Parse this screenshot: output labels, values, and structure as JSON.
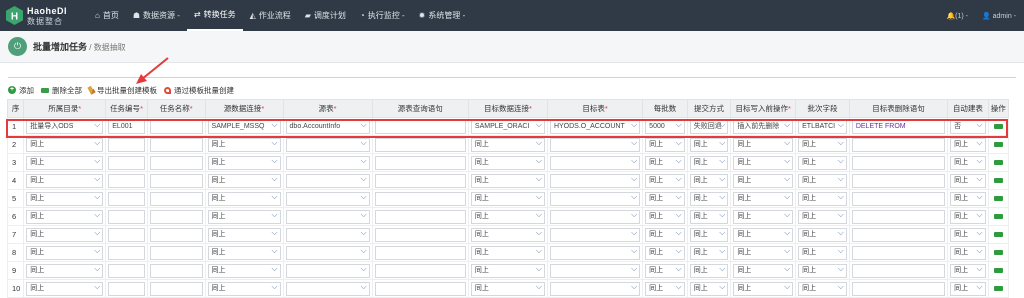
{
  "app": {
    "logo_title": "HaoheDI",
    "logo_subtitle": "数据整合"
  },
  "nav": {
    "items": [
      {
        "icon": "home-icon",
        "glyph": "⌂",
        "label": "首页",
        "active": false
      },
      {
        "icon": "database-icon",
        "glyph": "☗",
        "label": "数据资源 -",
        "active": false
      },
      {
        "icon": "transform-icon",
        "glyph": "⇄",
        "label": "转换任务",
        "active": true
      },
      {
        "icon": "workflow-icon",
        "glyph": "◭",
        "label": "作业流程",
        "active": false
      },
      {
        "icon": "schedule-icon",
        "glyph": "▰",
        "label": "调度计划",
        "active": false
      },
      {
        "icon": "monitor-icon",
        "glyph": "◔",
        "label": "执行监控 -",
        "active": false
      },
      {
        "icon": "settings-icon",
        "glyph": "✹",
        "label": "系统管理 -",
        "active": false
      }
    ],
    "notifications": "🔔(1) -",
    "user": "👤 admin -"
  },
  "breadcrumb": {
    "title": "批量增加任务",
    "separator": " / ",
    "sub": "数据抽取"
  },
  "toolbar": {
    "add": "添加",
    "delete_all": "删除全部",
    "export_template": "导出批量创建模板",
    "import_template": "通过模板批量创建"
  },
  "table": {
    "headers": [
      {
        "label": "序",
        "req": false
      },
      {
        "label": "所属目录",
        "req": true
      },
      {
        "label": "任务编号",
        "req": true
      },
      {
        "label": "任务名称",
        "req": true
      },
      {
        "label": "源数据连接",
        "req": true
      },
      {
        "label": "源表",
        "req": true
      },
      {
        "label": "源表查询语句",
        "req": false
      },
      {
        "label": "目标数据连接",
        "req": true
      },
      {
        "label": "目标表",
        "req": true
      },
      {
        "label": "每批数",
        "req": false
      },
      {
        "label": "提交方式",
        "req": false
      },
      {
        "label": "目标写入前操作",
        "req": true
      },
      {
        "label": "批次字段",
        "req": false
      },
      {
        "label": "目标表删除语句",
        "req": false
      },
      {
        "label": "自动建表",
        "req": false
      },
      {
        "label": "操作",
        "req": false
      }
    ],
    "rows": [
      {
        "no": "1",
        "dir": "批量导入ODS",
        "code": "EL001",
        "name": "",
        "src_conn": "SAMPLE_MSSQ",
        "src_table": "dbo.AccountInfo",
        "src_sql": "",
        "tgt_conn": "SAMPLE_ORACI",
        "tgt_table": "HYODS.O_ACCOUNT",
        "batch": "5000",
        "commit": "失败回退",
        "pre_op": "插入前先删除",
        "batch_field": "ETLBATCI",
        "del_sql": "DELETE  FROM",
        "auto_create": "否"
      },
      {
        "no": "2",
        "dir": "同上",
        "code": "",
        "name": "",
        "src_conn": "同上",
        "src_table": "",
        "src_sql": "",
        "tgt_conn": "同上",
        "tgt_table": "",
        "batch": "同上",
        "commit": "同上",
        "pre_op": "同上",
        "batch_field": "同上",
        "del_sql": "",
        "auto_create": "同上"
      },
      {
        "no": "3",
        "dir": "同上",
        "code": "",
        "name": "",
        "src_conn": "同上",
        "src_table": "",
        "src_sql": "",
        "tgt_conn": "同上",
        "tgt_table": "",
        "batch": "同上",
        "commit": "同上",
        "pre_op": "同上",
        "batch_field": "同上",
        "del_sql": "",
        "auto_create": "同上"
      },
      {
        "no": "4",
        "dir": "同上",
        "code": "",
        "name": "",
        "src_conn": "同上",
        "src_table": "",
        "src_sql": "",
        "tgt_conn": "同上",
        "tgt_table": "",
        "batch": "同上",
        "commit": "同上",
        "pre_op": "同上",
        "batch_field": "同上",
        "del_sql": "",
        "auto_create": "同上"
      },
      {
        "no": "5",
        "dir": "同上",
        "code": "",
        "name": "",
        "src_conn": "同上",
        "src_table": "",
        "src_sql": "",
        "tgt_conn": "同上",
        "tgt_table": "",
        "batch": "同上",
        "commit": "同上",
        "pre_op": "同上",
        "batch_field": "同上",
        "del_sql": "",
        "auto_create": "同上"
      },
      {
        "no": "6",
        "dir": "同上",
        "code": "",
        "name": "",
        "src_conn": "同上",
        "src_table": "",
        "src_sql": "",
        "tgt_conn": "同上",
        "tgt_table": "",
        "batch": "同上",
        "commit": "同上",
        "pre_op": "同上",
        "batch_field": "同上",
        "del_sql": "",
        "auto_create": "同上"
      },
      {
        "no": "7",
        "dir": "同上",
        "code": "",
        "name": "",
        "src_conn": "同上",
        "src_table": "",
        "src_sql": "",
        "tgt_conn": "同上",
        "tgt_table": "",
        "batch": "同上",
        "commit": "同上",
        "pre_op": "同上",
        "batch_field": "同上",
        "del_sql": "",
        "auto_create": "同上"
      },
      {
        "no": "8",
        "dir": "同上",
        "code": "",
        "name": "",
        "src_conn": "同上",
        "src_table": "",
        "src_sql": "",
        "tgt_conn": "同上",
        "tgt_table": "",
        "batch": "同上",
        "commit": "同上",
        "pre_op": "同上",
        "batch_field": "同上",
        "del_sql": "",
        "auto_create": "同上"
      },
      {
        "no": "9",
        "dir": "同上",
        "code": "",
        "name": "",
        "src_conn": "同上",
        "src_table": "",
        "src_sql": "",
        "tgt_conn": "同上",
        "tgt_table": "",
        "batch": "同上",
        "commit": "同上",
        "pre_op": "同上",
        "batch_field": "同上",
        "del_sql": "",
        "auto_create": "同上"
      },
      {
        "no": "10",
        "dir": "同上",
        "code": "",
        "name": "",
        "src_conn": "同上",
        "src_table": "",
        "src_sql": "",
        "tgt_conn": "同上",
        "tgt_table": "",
        "batch": "同上",
        "commit": "同上",
        "pre_op": "同上",
        "batch_field": "同上",
        "del_sql": "",
        "auto_create": "同上"
      }
    ]
  },
  "colors": {
    "topbar": "#2f3a46",
    "highlight": "#e33b3b",
    "accent_green": "#2e9b3f"
  }
}
